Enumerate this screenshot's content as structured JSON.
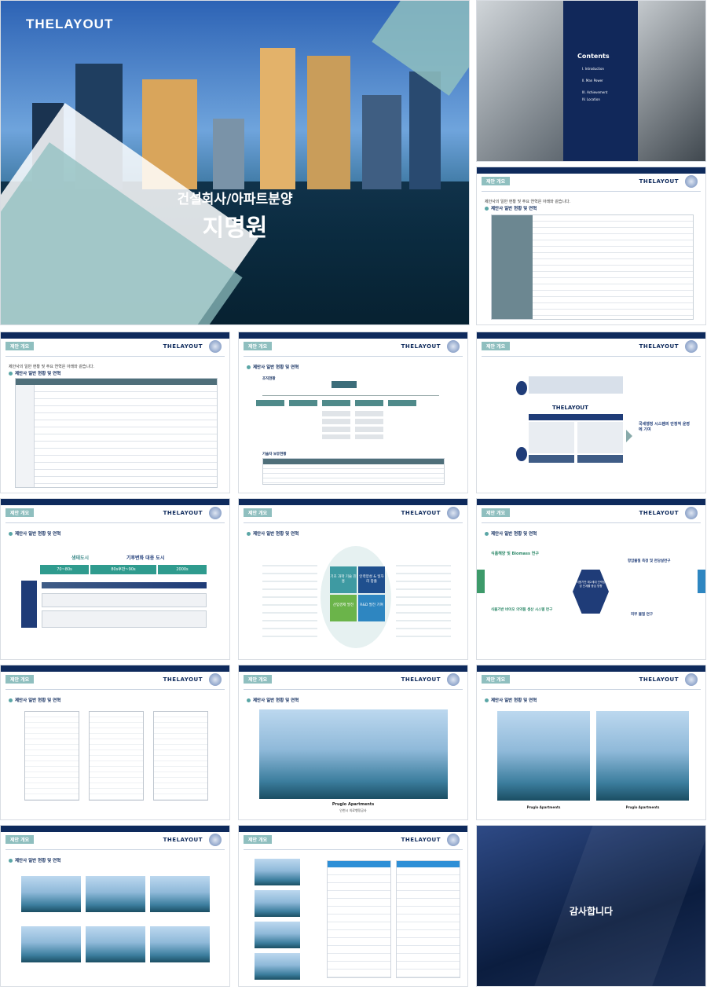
{
  "cover": {
    "logo": "THELAYOUT",
    "title": "건설회사/아파트분양",
    "subtitle": "지명원"
  },
  "contents": {
    "title": "Contents",
    "items": [
      "I. Introduction",
      "II. Man Power",
      "III. Achievement",
      "IV. Location"
    ]
  },
  "common": {
    "tag": "제안 개요",
    "logo": "THELAYOUT",
    "subtitle": "제안사의 일반 현황 및 주요 연혁은 아래와 같습니다.",
    "section": "제안사 일반 현황 및 연혁"
  },
  "slides": {
    "org": {
      "head": "조직현황",
      "staff": "기술자 보유현황"
    },
    "diagram": {
      "title": "THELAYOUT",
      "right_text": "국세행정 시스템의 안정적 운영에 기여"
    },
    "timeline": {
      "main": "생태도시",
      "arrow": "기후변화 대응 도시",
      "eras": [
        "70~80s",
        "80s후반~90s",
        "2000s"
      ]
    },
    "center": {
      "q1": "기초 과학 기술 진흥",
      "q2": "인력양성 & 일자리 창출",
      "q3": "산업경제 발전",
      "q4": "R&D 발전 기여"
    },
    "biomass": {
      "left": "식품해양 및 Biomass 연구",
      "right": "항암물질 측정 및 천당살연구",
      "center": "식품기반 제2세대 인력양성 단계를 중심 방향",
      "bottom_left": "식물기반 바이오 의약품 생산 시스템 연구",
      "bottom_right": "피부 물질 연구"
    },
    "apt": {
      "caption": "Pruglo Apartments",
      "caption_sub": "인천시 의료행정공사"
    },
    "thanks": "감사합니다"
  }
}
